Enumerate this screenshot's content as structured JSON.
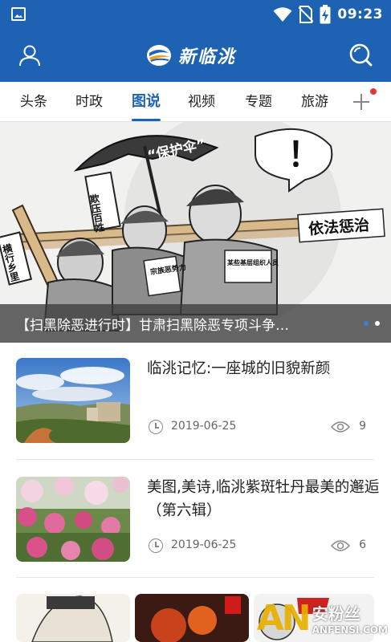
{
  "status_bar": {
    "time": "09:23",
    "icons": [
      "image-icon",
      "wifi-icon",
      "no-sim-icon",
      "battery-charging-icon"
    ]
  },
  "app_bar": {
    "logo_text": "新临洮",
    "left_icon": "user-icon",
    "right_icon": "search-icon"
  },
  "tabs": [
    {
      "label": "头条"
    },
    {
      "label": "时政"
    },
    {
      "label": "图说",
      "active": true
    },
    {
      "label": "视频"
    },
    {
      "label": "专题"
    },
    {
      "label": "旅游"
    }
  ],
  "banner": {
    "caption": "【扫黑除恶进行时】甘肃扫黑除恶专项斗争…",
    "slides": 2,
    "active_slide": 1,
    "cartoon_text": {
      "umbrella": "“保护伞”",
      "sign1": "欺压百姓",
      "sign2": "横行乡里",
      "sign3": "依法惩治",
      "shirt1": "宗族恶势力",
      "shirt2": "某些基层组织人员",
      "exclaim": "！"
    }
  },
  "news": [
    {
      "title": "临洮记忆:一座城的旧貌新颜",
      "date": "2019-06-25",
      "views": "9"
    },
    {
      "title": "美图,美诗,临洮紫斑牡丹最美的邂逅（第六辑）",
      "date": "2019-06-25",
      "views": "6"
    }
  ],
  "watermark": {
    "brand": "AN",
    "cn": "安粉丝",
    "en": "ANFENSI.COM"
  },
  "colors": {
    "primary": "#1e63b3",
    "badge": "#e53935",
    "watermark": "#e9b000"
  }
}
